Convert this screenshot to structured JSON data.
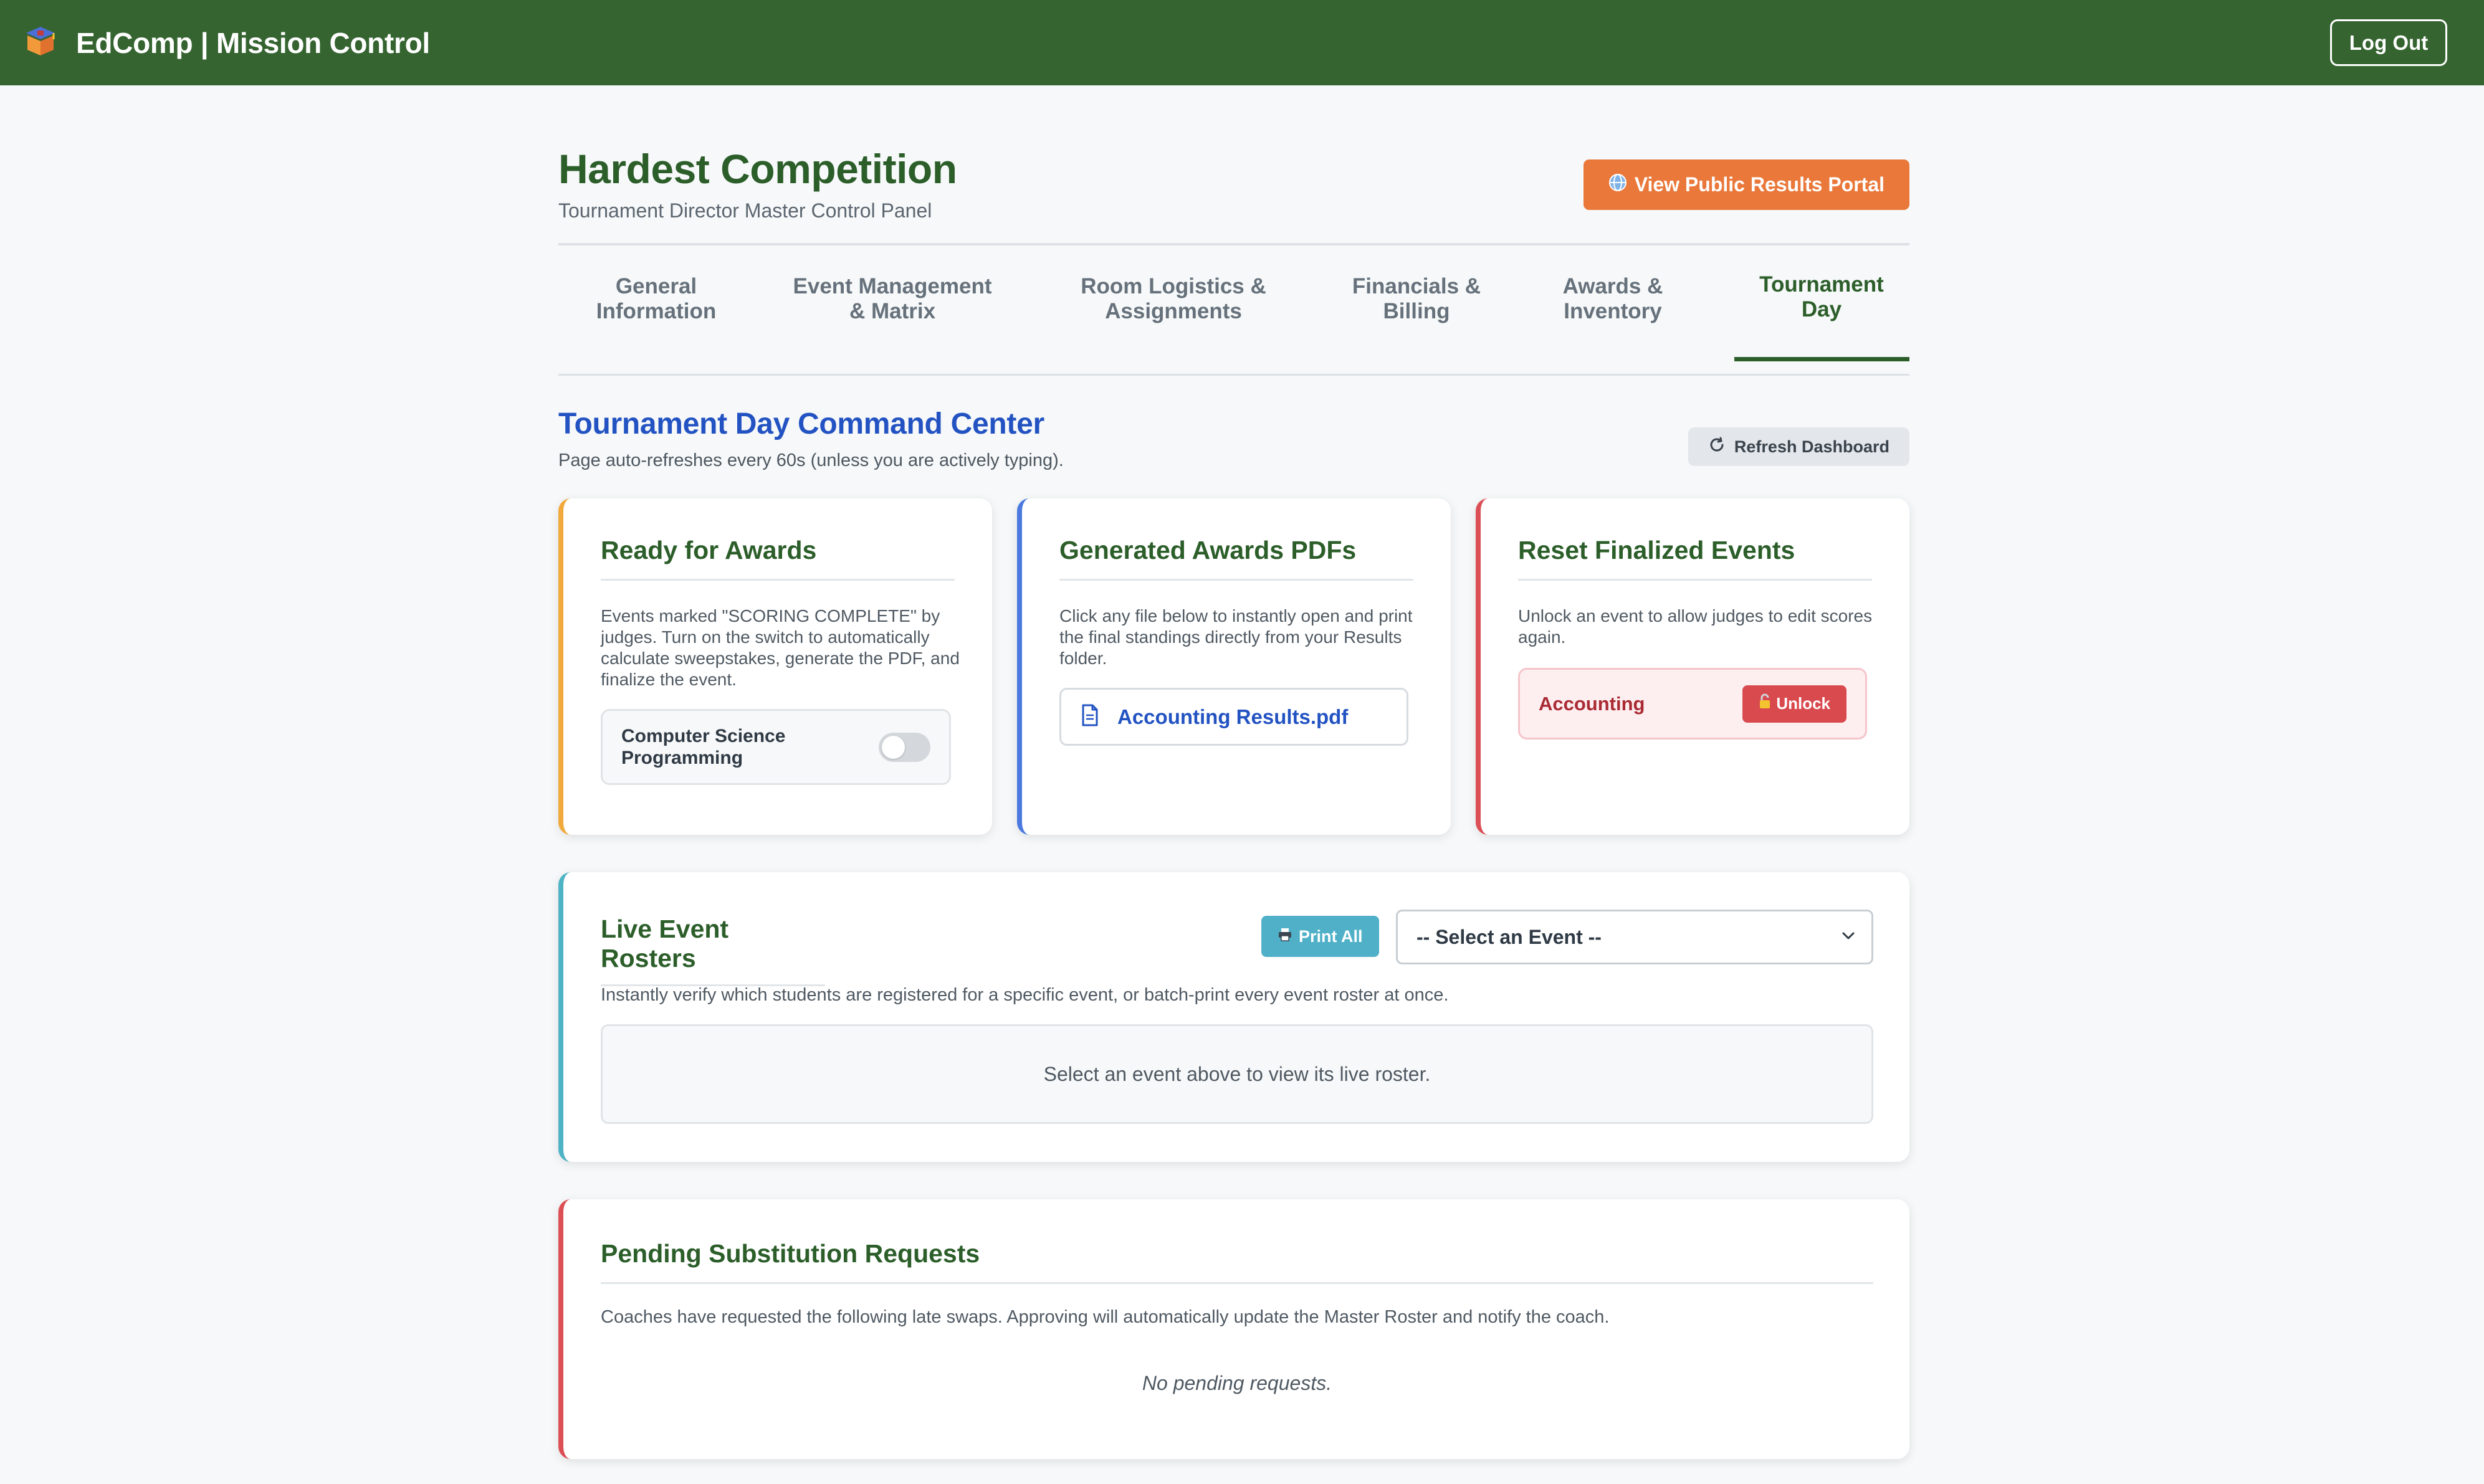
{
  "header": {
    "app_title": "EdComp | Mission Control",
    "logout_label": "Log Out",
    "logo_icon": "graduation-box-icon"
  },
  "page": {
    "title": "Hardest Competition",
    "subtitle": "Tournament Director Master Control Panel",
    "portal_button": "View Public Results Portal",
    "portal_icon": "globe-icon"
  },
  "tabs": [
    {
      "line1": "General",
      "line2": "Information",
      "active": false
    },
    {
      "line1": "Event Management",
      "line2": "& Matrix",
      "active": false
    },
    {
      "line1": "Room Logistics &",
      "line2": "Assignments",
      "active": false
    },
    {
      "line1": "Financials &",
      "line2": "Billing",
      "active": false
    },
    {
      "line1": "Awards &",
      "line2": "Inventory",
      "active": false
    },
    {
      "line1": "Tournament",
      "line2": "Day",
      "active": true
    }
  ],
  "command_center": {
    "title": "Tournament Day Command Center",
    "note": "Page auto-refreshes every 60s (unless you are actively typing).",
    "refresh_label": "Refresh Dashboard"
  },
  "ready_card": {
    "title": "Ready for Awards",
    "description": "Events marked \"SCORING COMPLETE\" by judges. Turn on the switch to automatically calculate sweepstakes, generate the PDF, and finalize the event.",
    "items": [
      {
        "line1": "Computer Science",
        "line2": "Programming",
        "enabled": false
      }
    ]
  },
  "pdf_card": {
    "title": "Generated Awards PDFs",
    "description": "Click any file below to instantly open and print the final standings directly from your Results folder.",
    "files": [
      "Accounting Results.pdf"
    ]
  },
  "reset_card": {
    "title": "Reset Finalized Events",
    "description": "Unlock an event to allow judges to edit scores again.",
    "events": [
      "Accounting"
    ],
    "unlock_label": "Unlock"
  },
  "rosters_card": {
    "title": "Live Event Rosters",
    "print_label": "Print All",
    "select_value": "-- Select an Event --",
    "description": "Instantly verify which students are registered for a specific event, or batch-print every event roster at once.",
    "placeholder": "Select an event above to view its live roster."
  },
  "substitution_card": {
    "title": "Pending Substitution Requests",
    "description": "Coaches have requested the following late swaps. Approving will automatically update the Master Roster and notify the coach.",
    "empty": "No pending requests."
  },
  "colors": {
    "topbar": "#356430",
    "heading_green": "#2c5e2a",
    "heading_blue": "#2353c2",
    "accent_orange": "#e9783a",
    "danger_red": "#d94a4f",
    "info_teal": "#4fb0c8"
  }
}
